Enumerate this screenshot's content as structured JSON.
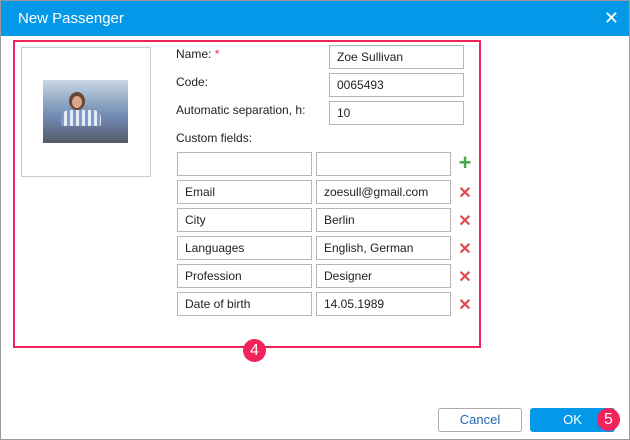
{
  "dialog": {
    "title": "New Passenger",
    "close_icon": "close-icon"
  },
  "form": {
    "name_label": "Name:",
    "required_mark": "*",
    "name_value": "Zoe Sullivan",
    "code_label": "Code:",
    "code_value": "0065493",
    "separation_label": "Automatic separation, h:",
    "separation_value": "10",
    "custom_label": "Custom fields:",
    "new_field": {
      "name": "",
      "value": ""
    },
    "custom_fields": [
      {
        "name": "Email",
        "value": "zoesull@gmail.com"
      },
      {
        "name": "City",
        "value": "Berlin"
      },
      {
        "name": "Languages",
        "value": "English, German"
      },
      {
        "name": "Profession",
        "value": "Designer"
      },
      {
        "name": "Date of birth",
        "value": "14.05.1989"
      }
    ],
    "add_icon": "+",
    "remove_icon": "✕"
  },
  "annotations": {
    "badge_4": "4",
    "badge_5": "5"
  },
  "buttons": {
    "cancel": "Cancel",
    "ok": "OK"
  },
  "colors": {
    "accent": "#0399e8",
    "highlight": "#f0245a"
  }
}
